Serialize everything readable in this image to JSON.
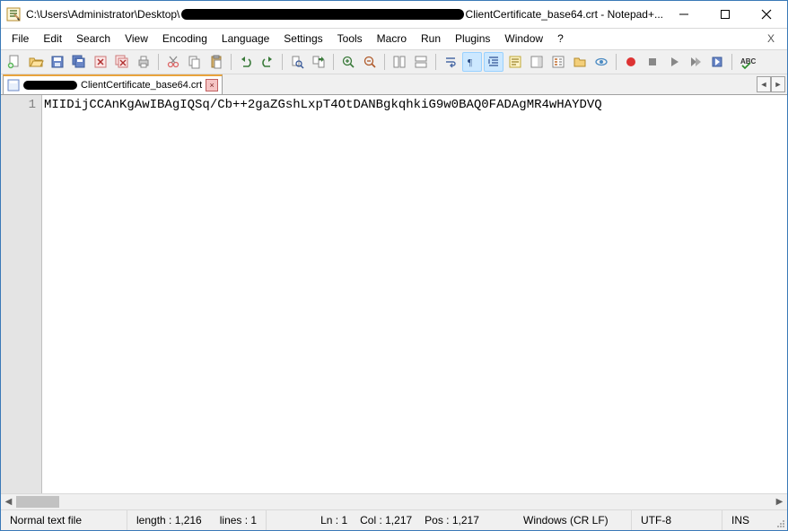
{
  "title": {
    "prefix": "C:\\Users\\Administrator\\Desktop\\",
    "suffix": "ClientCertificate_base64.crt - Notepad+..."
  },
  "menu": {
    "file": "File",
    "edit": "Edit",
    "search": "Search",
    "view": "View",
    "encoding": "Encoding",
    "language": "Language",
    "settings": "Settings",
    "tools": "Tools",
    "macro": "Macro",
    "run": "Run",
    "plugins": "Plugins",
    "window": "Window",
    "help": "?",
    "close_document": "X"
  },
  "tab": {
    "filename_suffix": "ClientCertificate_base64.crt"
  },
  "editor": {
    "line_number": "1",
    "content": "MIIDijCCAnKgAwIBAgIQSq/Cb++2gaZGshLxpT4OtDANBgkqhkiG9w0BAQ0FADAgMR4wHAYDVQ"
  },
  "status": {
    "type": "Normal text file",
    "length": "length : 1,216",
    "lines": "lines : 1",
    "ln": "Ln : 1",
    "col": "Col : 1,217",
    "pos": "Pos : 1,217",
    "eol": "Windows (CR LF)",
    "encoding": "UTF-8",
    "mode": "INS"
  }
}
